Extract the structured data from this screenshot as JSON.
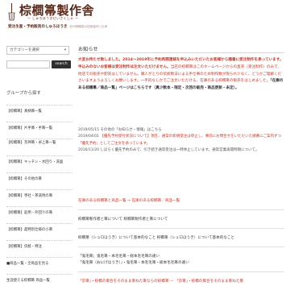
{
  "header": {
    "logo_title": "棕櫚箒製作舎",
    "logo_sub": "— しゅろぼうきせいさくしゃ —",
    "tagline": "受注生産・予約販売のしゅろほうき",
    "tagline_small": "紀州棕櫚箒の技術保存と伝承"
  },
  "sidebar": {
    "category_select": "カテゴリーを選択",
    "search_placeholder": "",
    "search_button": "search",
    "group_title": "グループから探す",
    "items": [
      "【棕櫚箒】真柄箒一覧",
      "【棕櫚箒】片手箒・手箒一覧",
      "【棕櫚箒】荒神箒・卓上箒一覧",
      "【棕櫚箒】キッチン・水回り・洗面",
      "【棕櫚箒】その他の箒",
      "【棕櫚箒】寺社・茶道用の箒",
      "【棕櫚箒】庭用・外回りの箒",
      "【棕櫚箒】超特別仕様の小箒",
      "【棕櫚箒】伝統・特注",
      "■商品一覧・全商品を見る",
      "生涯使える棕櫚箒 商品一覧"
    ]
  },
  "main": {
    "news_title": "お知らせ",
    "notice_bold": "大変お待たせ致しました。2014〜2019年に予約再開連絡を申込みいただいたお客様から順番に受注制作を承っています。申込みのないお客様は受注制作は注文いただけません。",
    "notice_normal": "当店の棕櫚箒はこのホームページからの直売（受注制作）のみで、他店での販売や卸売はしていません。職人がとりの伝統製法による手仕事のため制作数が限られ少なく、どうかご理解くださいますようよろしくお願いします。一手的なしかでご注文いただける、在庫のある棕櫚箒の販売をはじめました。",
    "notice_dark": "「在庫のある棕櫚箒／商品一覧」ページはこちらです（真少数本・限定・次回の販売・商品更新・未定）。",
    "news": [
      {
        "date": "2019/05/15",
        "text": "その他の「お知らせ・情報」はこちら"
      },
      {
        "date": "2019/04/01",
        "text": "【優先予約受付状況について】現在、通常の新規受注は停止し、事前にお問合せをいただいた順番にご案内ずつ「優先予約」としてご注文を承っています。"
      },
      {
        "date": "2016/11/20",
        "text": "しばらく優先予約のみで、引き続き通常受注は一時休止しています。通常営業再開時期について。"
      }
    ],
    "link_notice": "在庫のある棕櫚箒と商品一覧 → 在庫のある棕櫚箒／商品一覧",
    "link1_a": "棕櫚箒製作者と箒について",
    "link1_b": "棕櫚箒製作者と箒について",
    "link2_a": "棕櫚箒（シュロほうき）について基本的なこと",
    "link2_b": "棕櫚箒（シュロほうき）について基本的なこと",
    "link3_a": "「鬼毛箒」鬼毛箒・本毛毛箒・総本毛毛箒の違い",
    "link3_b": "「鬼毛箒（おにげほうき）」・鬼毛箒・本毛毛箒・総本毛毛箒の違い",
    "link4_a": "「京箒」・棕櫚の風合をそのまま束ねた箒ならの棕櫚箒 — 「京箒」・棕櫚の風合をそのまま束ねた箒"
  }
}
